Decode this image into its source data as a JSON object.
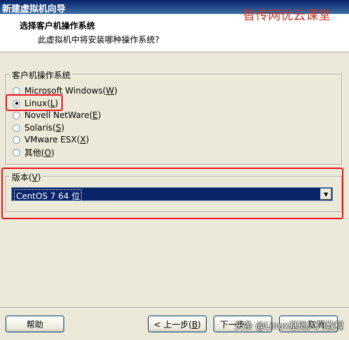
{
  "window": {
    "title": "新建虚拟机向导"
  },
  "watermark_top": "智传网优云课堂",
  "header": {
    "title": "选择客户机操作系统",
    "subtitle": "此虚拟机中将安装哪种操作系统?"
  },
  "os_group": {
    "label": "客户机操作系统",
    "options": [
      {
        "text": "Microsoft Windows(",
        "key": "W",
        "end": ")",
        "checked": false
      },
      {
        "text": "Linux(",
        "key": "L",
        "end": ")",
        "checked": true
      },
      {
        "text": "Novell NetWare(",
        "key": "E",
        "end": ")",
        "checked": false
      },
      {
        "text": "Solaris(",
        "key": "S",
        "end": ")",
        "checked": false
      },
      {
        "text": "VMware ESX(",
        "key": "X",
        "end": ")",
        "checked": false
      },
      {
        "text": "其他(",
        "key": "O",
        "end": ")",
        "checked": false
      }
    ]
  },
  "version_group": {
    "label": "版本(",
    "key": "V",
    "end": ")",
    "selected": "CentOS 7 64 位"
  },
  "buttons": {
    "help": "帮助",
    "back": "< 上一步(",
    "back_key": "B",
    "back_end": ")",
    "next": "下一步",
    "cancel": "取消"
  },
  "watermark_bottom": "头条 @Linux基础入门教程",
  "colors": {
    "highlight_box": "#e8141c",
    "selection": "#0a246a",
    "title_bar": "#0a246a"
  }
}
